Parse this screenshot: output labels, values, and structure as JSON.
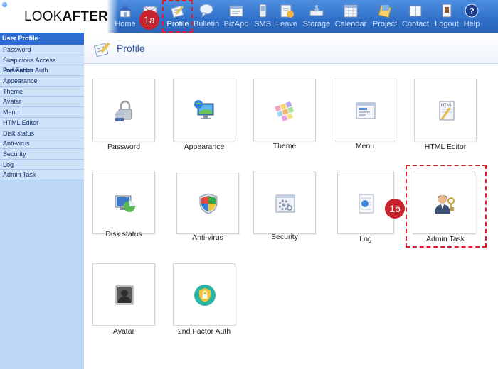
{
  "app": {
    "logo_light": "LOOK",
    "logo_bold": "AFTER"
  },
  "nav": [
    {
      "label": "Home",
      "icon": "home-icon"
    },
    {
      "label": "",
      "icon": "mail-icon"
    },
    {
      "label": "Profile",
      "icon": "profile-icon"
    },
    {
      "label": "Bulletin",
      "icon": "bulletin-icon"
    },
    {
      "label": "BizApp",
      "icon": "bizapp-icon"
    },
    {
      "label": "SMS",
      "icon": "sms-icon"
    },
    {
      "label": "Leave",
      "icon": "leave-icon"
    },
    {
      "label": "Storage",
      "icon": "storage-icon"
    },
    {
      "label": "Calendar",
      "icon": "calendar-icon"
    },
    {
      "label": "Project",
      "icon": "project-icon"
    },
    {
      "label": "Contact",
      "icon": "contact-icon"
    },
    {
      "label": "Logout",
      "icon": "logout-icon"
    },
    {
      "label": "Help",
      "icon": "help-icon"
    }
  ],
  "sidebar": {
    "header": "User Profile",
    "items": [
      {
        "label": "Password"
      },
      {
        "label": "Suspicious Access Prevention"
      },
      {
        "label": "2nd Factor Auth"
      },
      {
        "label": "Appearance"
      },
      {
        "label": "Theme"
      },
      {
        "label": "Avatar"
      },
      {
        "label": "Menu"
      },
      {
        "label": "HTML Editor"
      },
      {
        "label": "Disk status"
      },
      {
        "label": "Anti-virus"
      },
      {
        "label": "Security"
      },
      {
        "label": "Log"
      },
      {
        "label": "Admin Task"
      }
    ]
  },
  "page": {
    "title": "Profile"
  },
  "tiles": [
    {
      "label": "Password",
      "icon": "password-lock-icon"
    },
    {
      "label": "Appearance",
      "icon": "appearance-monitor-icon"
    },
    {
      "label": "Theme",
      "icon": "theme-palette-icon"
    },
    {
      "label": "Menu",
      "icon": "menu-window-icon"
    },
    {
      "label": "HTML Editor",
      "icon": "html-editor-icon"
    },
    {
      "label": "Disk status",
      "icon": "disk-status-icon"
    },
    {
      "label": "Anti-virus",
      "icon": "antivirus-shield-icon"
    },
    {
      "label": "Security",
      "icon": "security-gear-icon"
    },
    {
      "label": "Log",
      "icon": "log-document-icon"
    },
    {
      "label": "Admin Task",
      "icon": "admin-task-icon"
    },
    {
      "label": "Avatar",
      "icon": "avatar-icon"
    },
    {
      "label": "2nd Factor Auth",
      "icon": "two-factor-shield-icon"
    }
  ],
  "callouts": {
    "first": "1a",
    "second": "1b"
  },
  "colors": {
    "topbar": "#2f6fc8",
    "sidebar_header": "#2d6cd1",
    "callout": "#c8232c",
    "highlight_dash": "#d9202b"
  }
}
